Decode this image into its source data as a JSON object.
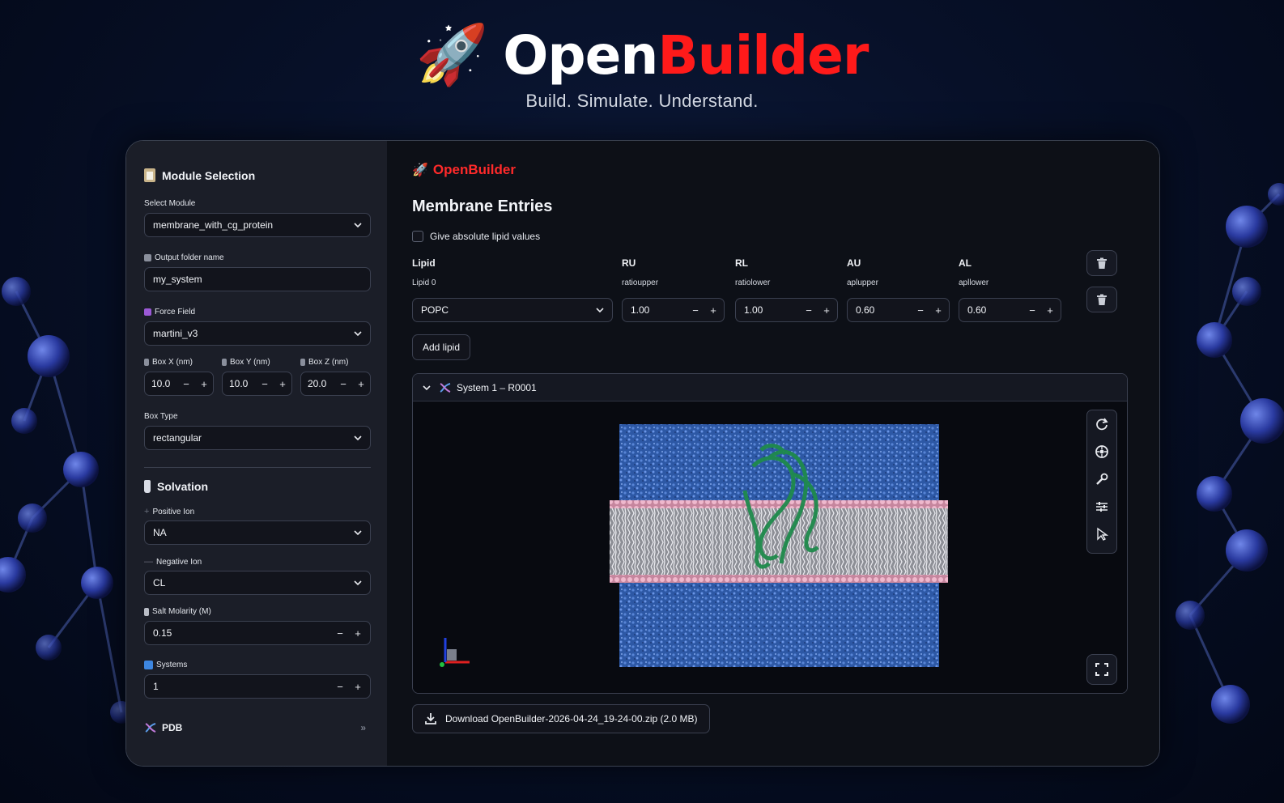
{
  "hero": {
    "rocket": "🚀",
    "brand_open": "Open",
    "brand_builder": "Builder",
    "tagline": "Build. Simulate. Understand."
  },
  "sidebar": {
    "module_selection": {
      "icon": "clipboard-icon",
      "title": "Module Selection"
    },
    "select_module": {
      "label": "Select Module",
      "value": "membrane_with_cg_protein"
    },
    "output_folder": {
      "label": "Output folder name",
      "value": "my_system"
    },
    "force_field": {
      "label": "Force Field",
      "value": "martini_v3"
    },
    "box": [
      {
        "label": "Box X (nm)",
        "value": "10.0"
      },
      {
        "label": "Box Y (nm)",
        "value": "10.0"
      },
      {
        "label": "Box Z (nm)",
        "value": "20.0"
      }
    ],
    "box_type": {
      "label": "Box Type",
      "value": "rectangular"
    },
    "solvation": {
      "icon": "bottle-icon",
      "title": "Solvation"
    },
    "positive_ion": {
      "label": "Positive Ion",
      "value": "NA"
    },
    "negative_ion": {
      "label": "Negative Ion",
      "value": "CL"
    },
    "salt_molarity": {
      "label": "Salt Molarity (M)",
      "value": "0.15"
    },
    "systems": {
      "label": "Systems",
      "value": "1"
    },
    "pdb": {
      "label": "PDB"
    },
    "stepper": {
      "minus": "−",
      "plus": "+"
    }
  },
  "main": {
    "brand": "OpenBuilder",
    "heading": "Membrane Entries",
    "absolute_checkbox": {
      "label": "Give absolute lipid values",
      "checked": false
    },
    "columns": [
      {
        "header": "Lipid",
        "sub": "Lipid 0"
      },
      {
        "header": "RU",
        "sub": "ratioupper"
      },
      {
        "header": "RL",
        "sub": "ratiolower"
      },
      {
        "header": "AU",
        "sub": "aplupper"
      },
      {
        "header": "AL",
        "sub": "apllower"
      }
    ],
    "row": {
      "lipid": "POPC",
      "ru": "1.00",
      "rl": "1.00",
      "au": "0.60",
      "al": "0.60"
    },
    "add_lipid": "Add lipid",
    "system": {
      "title": "System 1 – R0001"
    },
    "viewer_tools": [
      "rotate-icon",
      "spin-icon",
      "wrench-icon",
      "sliders-icon",
      "pointer-icon"
    ],
    "download": "Download OpenBuilder-2026-04-24_19-24-00.zip (2.0 MB)"
  },
  "colors": {
    "accent_red": "#ff1a1a",
    "water_blue": "#3d6fc8",
    "protein_green": "#1f8a4c",
    "headgroup_pink": "#e0a0b8"
  }
}
